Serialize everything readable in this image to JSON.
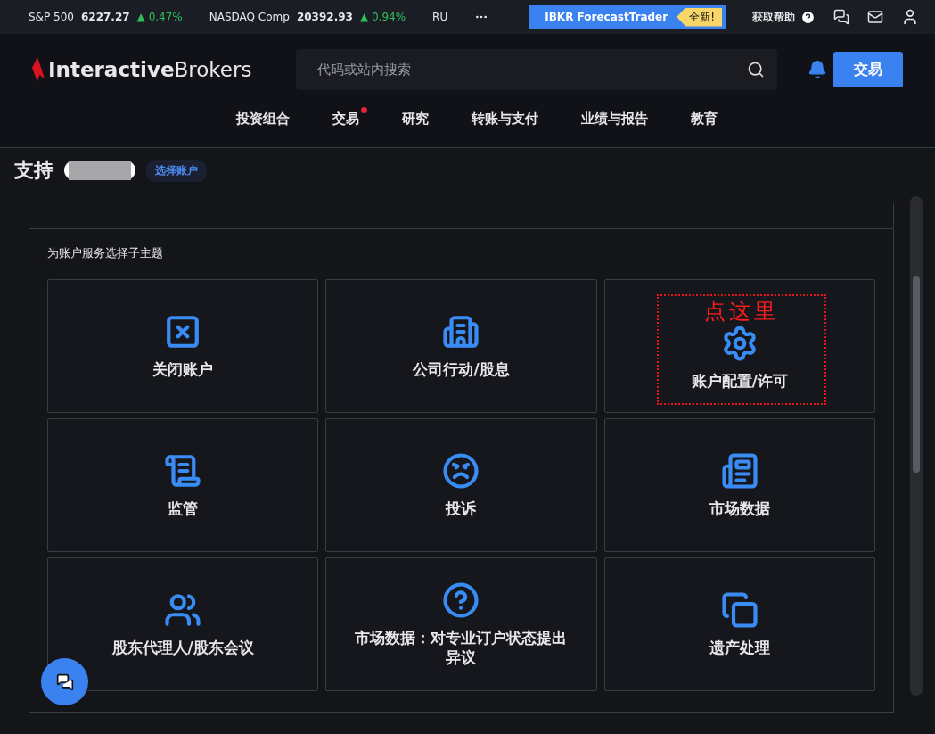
{
  "ticker": [
    {
      "name": "S&P 500",
      "value": "6227.27",
      "change": "▲ 0.47%"
    },
    {
      "name": "NASDAQ Comp",
      "value": "20392.93",
      "change": "▲ 0.94%"
    },
    {
      "name": "RU"
    }
  ],
  "promo": {
    "label": "IBKR ForecastTrader",
    "badge": "全新!"
  },
  "help": "获取帮助",
  "logo": {
    "bold": "Interactive",
    "light": "Brokers"
  },
  "search": {
    "placeholder": "代码或站内搜索"
  },
  "trade_button": "交易",
  "nav": [
    {
      "label": "投资组合",
      "dot": false
    },
    {
      "label": "交易",
      "dot": true
    },
    {
      "label": "研究",
      "dot": false
    },
    {
      "label": "转账与支付",
      "dot": false
    },
    {
      "label": "业绩与报告",
      "dot": false
    },
    {
      "label": "教育",
      "dot": false
    }
  ],
  "page_title": "支持",
  "select_account": "选择账户",
  "subtitle": "为账户服务选择子主题",
  "tiles": [
    {
      "label": "关闭账户"
    },
    {
      "label": "公司行动/股息"
    },
    {
      "label": "账户配置/许可",
      "annotation": "点这里"
    },
    {
      "label": "监管"
    },
    {
      "label": "投诉"
    },
    {
      "label": "市场数据"
    },
    {
      "label": "股东代理人/股东会议"
    },
    {
      "label": "市场数据：对专业订户状态提出异议"
    },
    {
      "label": "遗产处理"
    }
  ]
}
